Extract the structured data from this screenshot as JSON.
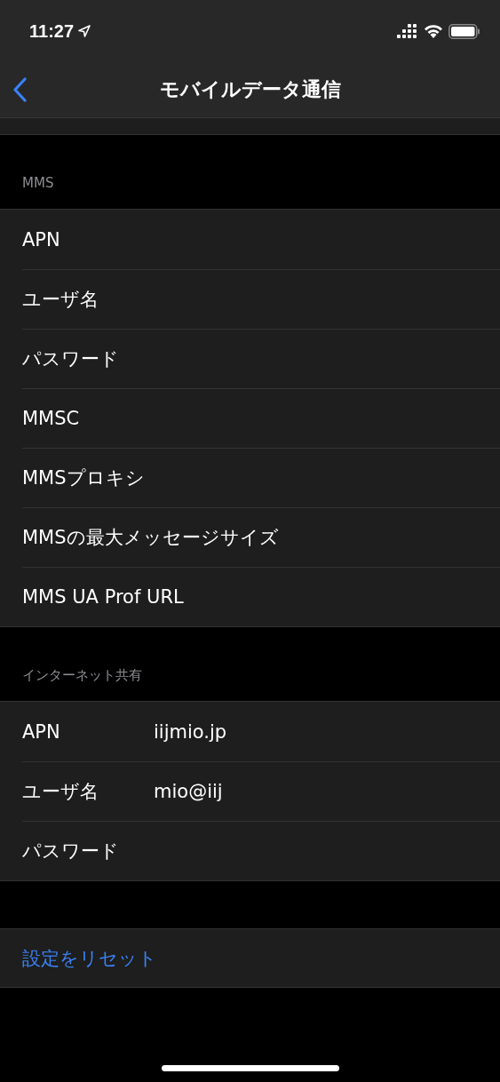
{
  "status_bar": {
    "time": "11:27"
  },
  "nav": {
    "title": "モバイルデータ通信"
  },
  "sections": [
    {
      "header": "MMS",
      "rows": [
        {
          "label": "APN"
        },
        {
          "label": "ユーザ名"
        },
        {
          "label": "パスワード"
        },
        {
          "label": "MMSC"
        },
        {
          "label": "MMSプロキシ"
        },
        {
          "label": "MMSの最大メッセージサイズ"
        },
        {
          "label": "MMS UA Prof URL"
        }
      ]
    },
    {
      "header": "インターネット共有",
      "rows": [
        {
          "label": "APN",
          "value": "iijmio.jp"
        },
        {
          "label": "ユーザ名",
          "value": "mio@iij"
        },
        {
          "label": "パスワード"
        }
      ]
    }
  ],
  "reset_button": "設定をリセット"
}
